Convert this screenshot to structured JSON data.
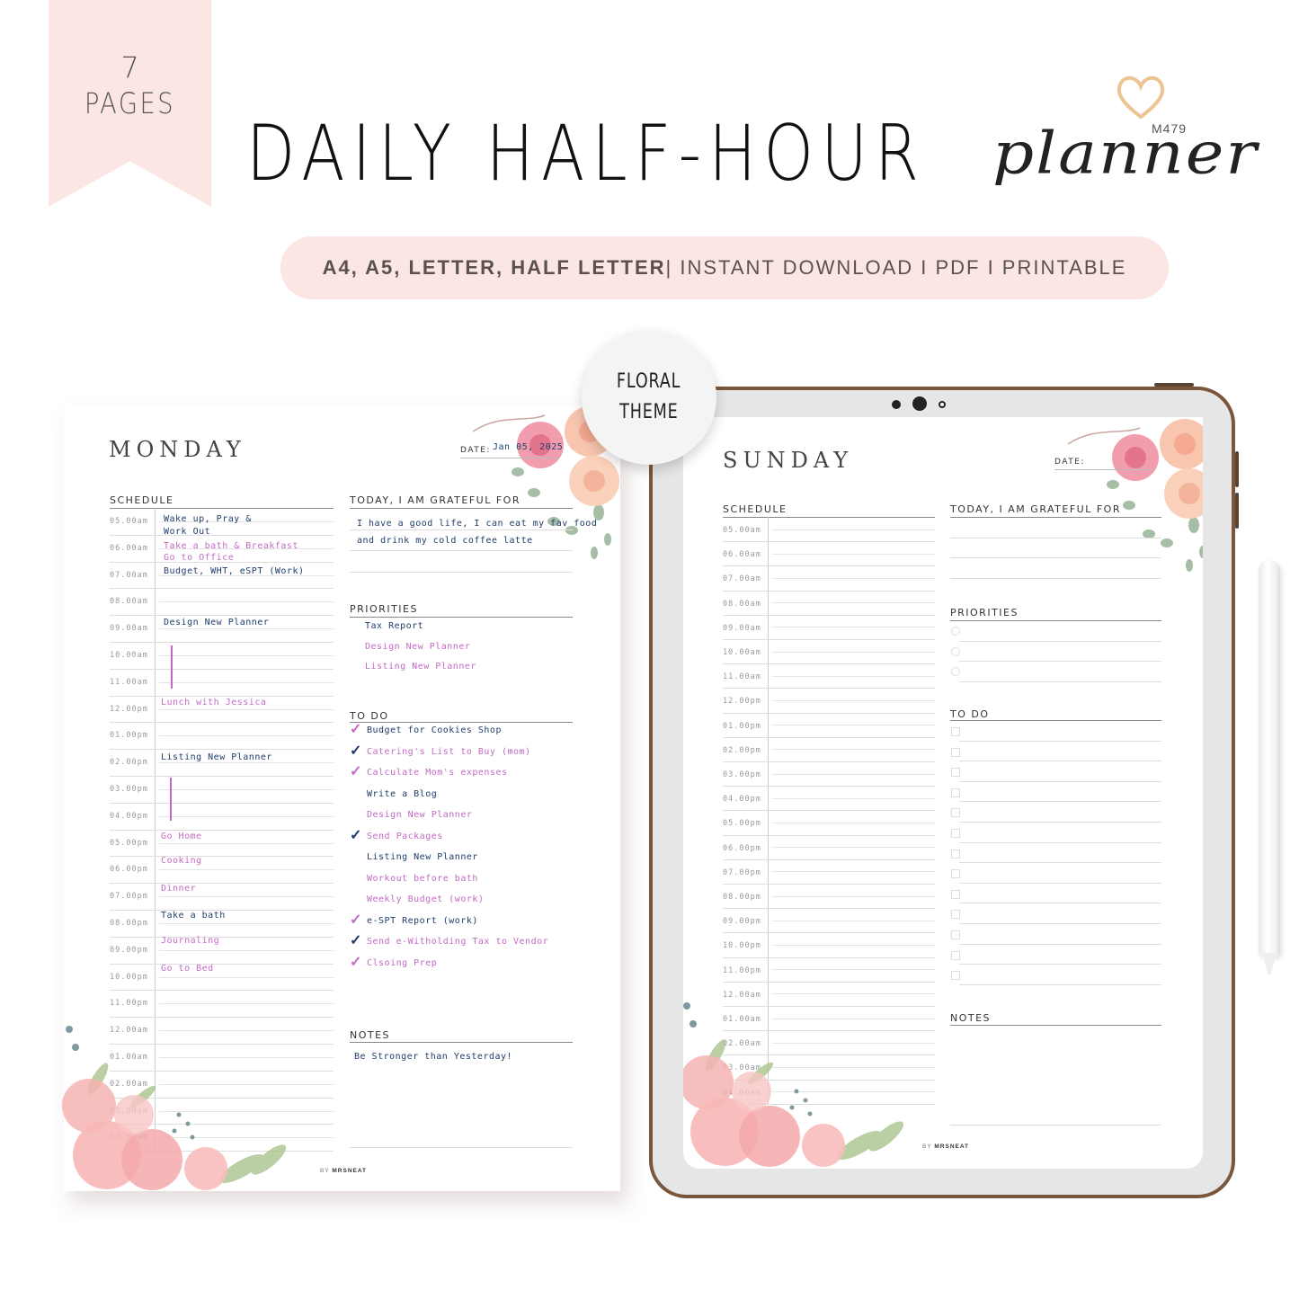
{
  "ribbon": {
    "count": "7",
    "label": "PAGES"
  },
  "header": {
    "title": "DAILY HALF-HOUR",
    "script_word": "planner",
    "product_code": "M479",
    "heart_icon": "heart-icon"
  },
  "banner": {
    "sizes": "A4, A5, LETTER, HALF LETTER",
    "rest": "| INSTANT DOWNLOAD I PDF I PRINTABLE"
  },
  "badge": {
    "line1": "FLORAL",
    "line2": "THEME"
  },
  "colors": {
    "pink_bg": "#fce6e4",
    "ipad_frame": "#7a573c",
    "navy_ink": "#1e3d6b",
    "pink_ink": "#c36ac6"
  },
  "monday": {
    "day": "MONDAY",
    "date_label": "DATE:",
    "date_value": "Jan 05, 2025",
    "schedule_title": "SCHEDULE",
    "times": [
      "05.00am",
      "06.00am",
      "07.00am",
      "08.00am",
      "09.00am",
      "10.00am",
      "11.00am",
      "12.00pm",
      "01.00pm",
      "02.00pm",
      "03.00pm",
      "04.00pm",
      "05.00pm",
      "06.00pm",
      "07.00pm",
      "08.00pm",
      "09.00pm",
      "10.00pm",
      "11.00pm",
      "12.00am",
      "01.00am",
      "02.00am",
      "03.00am",
      "04.00am"
    ],
    "entries": [
      {
        "text": "Wake up, Pray &",
        "ink": "navy"
      },
      {
        "text": "Work Out",
        "ink": "navy"
      },
      {
        "text": "Take a bath & Breakfast",
        "ink": "pink"
      },
      {
        "text": "Go to Office",
        "ink": "pink"
      },
      {
        "text": "Budget, WHT, eSPT (Work)",
        "ink": "navy"
      },
      {
        "text": "Design New Planner",
        "ink": "navy"
      },
      {
        "text": "Lunch with Jessica",
        "ink": "pink"
      },
      {
        "text": "Listing New Planner",
        "ink": "navy"
      },
      {
        "text": "Go Home",
        "ink": "pink"
      },
      {
        "text": "Cooking",
        "ink": "pink"
      },
      {
        "text": "Dinner",
        "ink": "pink"
      },
      {
        "text": "Take a bath",
        "ink": "navy"
      },
      {
        "text": "Journaling",
        "ink": "pink"
      },
      {
        "text": "Go to Bed",
        "ink": "pink"
      }
    ],
    "grateful_title": "TODAY, I AM GRATEFUL FOR",
    "grateful_lines": [
      "I have a good life, I can eat my fav food",
      "and drink my cold coffee latte"
    ],
    "priorities_title": "PRIORITIES",
    "priorities": [
      {
        "text": "Tax Report",
        "ink": "navy"
      },
      {
        "text": "Design New Planner",
        "ink": "pink"
      },
      {
        "text": "Listing New Planner",
        "ink": "pink"
      }
    ],
    "todo_title": "TO DO",
    "todos": [
      {
        "text": "Budget for Cookies Shop",
        "ink": "navy",
        "checked": true,
        "check_ink": "pink"
      },
      {
        "text": "Catering's List to Buy (mom)",
        "ink": "pink",
        "checked": true,
        "check_ink": "navy"
      },
      {
        "text": "Calculate Mom's expenses",
        "ink": "pink",
        "checked": true,
        "check_ink": "pink"
      },
      {
        "text": "Write a Blog",
        "ink": "navy",
        "checked": false
      },
      {
        "text": "Design New Planner",
        "ink": "pink",
        "checked": false
      },
      {
        "text": "Send Packages",
        "ink": "pink",
        "checked": true,
        "check_ink": "navy"
      },
      {
        "text": "Listing New Planner",
        "ink": "navy",
        "checked": false
      },
      {
        "text": "Workout before bath",
        "ink": "pink",
        "checked": false
      },
      {
        "text": "Weekly Budget (work)",
        "ink": "pink",
        "checked": false
      },
      {
        "text": "e-SPT Report (work)",
        "ink": "navy",
        "checked": true,
        "check_ink": "pink"
      },
      {
        "text": "Send e-Witholding Tax to Vendor",
        "ink": "pink",
        "checked": true,
        "check_ink": "navy"
      },
      {
        "text": "Clsoing Prep",
        "ink": "pink",
        "checked": true,
        "check_ink": "pink"
      },
      {
        "text": "",
        "ink": "navy",
        "checked": false
      }
    ],
    "notes_title": "NOTES",
    "notes_text": "Be Stronger than Yesterday!",
    "brand_by": "BY",
    "brand_name": "MRSNEAT"
  },
  "sunday": {
    "day": "SUNDAY",
    "date_label": "DATE:",
    "schedule_title": "SCHEDULE",
    "times": [
      "05.00am",
      "06.00am",
      "07.00am",
      "08.00am",
      "09.00am",
      "10.00am",
      "11.00am",
      "12.00pm",
      "01.00pm",
      "02.00pm",
      "03.00pm",
      "04.00pm",
      "05.00pm",
      "06.00pm",
      "07.00pm",
      "08.00pm",
      "09.00pm",
      "10.00pm",
      "11.00pm",
      "12.00am",
      "01.00am",
      "02.00am",
      "03.00am",
      "04.00am"
    ],
    "grateful_title": "TODAY, I AM GRATEFUL FOR",
    "priorities_title": "PRIORITIES",
    "priority_count": 3,
    "todo_title": "TO DO",
    "todo_count": 13,
    "notes_title": "NOTES",
    "brand_by": "BY",
    "brand_name": "MRSNEAT"
  }
}
